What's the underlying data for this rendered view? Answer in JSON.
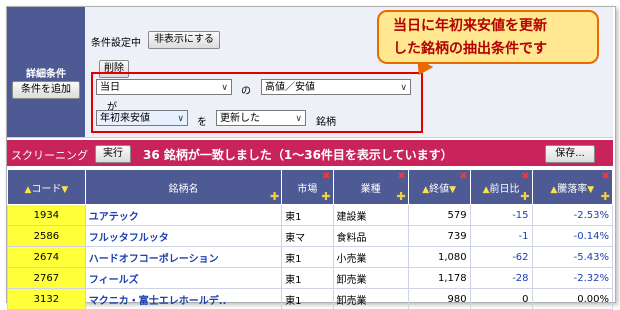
{
  "panel": {
    "left_title": "詳細条件",
    "add_condition_button": "条件を追加",
    "status_label": "条件設定中",
    "hide_button": "非表示にする",
    "delete_button": "削除",
    "row1": {
      "select_a": "当日",
      "connector_of": "の",
      "select_b": "高値／安値"
    },
    "ga_label": "が",
    "row2": {
      "select_a": "年初来安値",
      "connector_wo": "を",
      "select_b": "更新した",
      "suffix": "銘柄"
    }
  },
  "callout": {
    "line1": "当日に年初来安値を更新",
    "line2": "した銘柄の抽出条件です"
  },
  "screening": {
    "label": "スクリーニング",
    "run_button": "実行",
    "message": "36 銘柄が一致しました（1〜36件目を表示しています）",
    "save_button": "保存..."
  },
  "table": {
    "headers": [
      "コード",
      "銘柄名",
      "市場",
      "業種",
      "終値",
      "前日比",
      "騰落率"
    ],
    "rows": [
      {
        "code": "1934",
        "name": "ユアテック",
        "market": "東1",
        "sector": "建設業",
        "close": "579",
        "change": "-15",
        "rate": "-2.53%"
      },
      {
        "code": "2586",
        "name": "フルッタフルッタ",
        "market": "東マ",
        "sector": "食料品",
        "close": "739",
        "change": "-1",
        "rate": "-0.14%"
      },
      {
        "code": "2674",
        "name": "ハードオフコーポレーション",
        "market": "東1",
        "sector": "小売業",
        "close": "1,080",
        "change": "-62",
        "rate": "-5.43%"
      },
      {
        "code": "2767",
        "name": "フィールズ",
        "market": "東1",
        "sector": "卸売業",
        "close": "1,178",
        "change": "-28",
        "rate": "-2.32%"
      },
      {
        "code": "3132",
        "name": "マクニカ・富士エレホールデ..",
        "market": "東1",
        "sector": "卸売業",
        "close": "980",
        "change": "0",
        "rate": "0.00%"
      }
    ]
  },
  "colors": {
    "header_bg": "#4d5a94",
    "screen_bar": "#c8235a",
    "code_bg": "#ffff3a",
    "callout_bg": "#ffe890"
  }
}
